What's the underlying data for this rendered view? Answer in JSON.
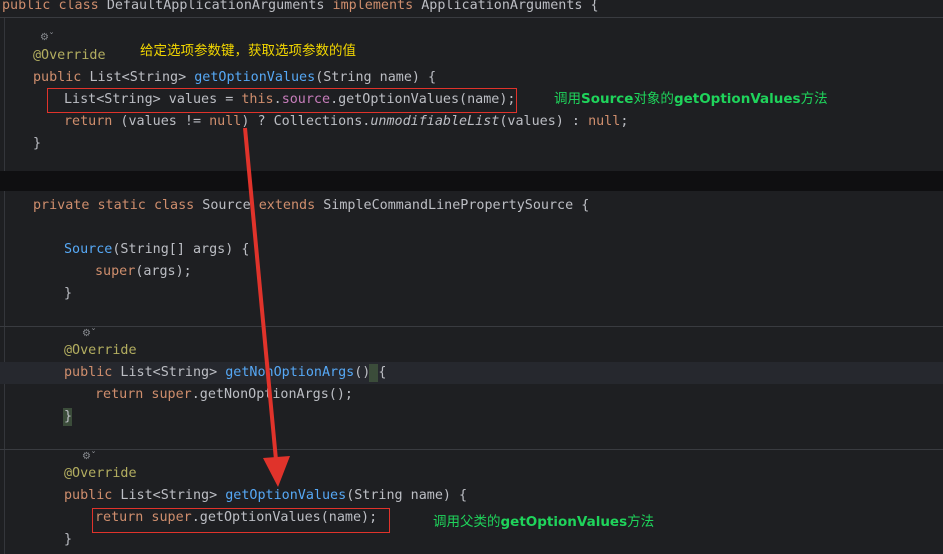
{
  "class_header": "public class DefaultApplicationArguments implements ApplicationArguments {",
  "class_header_parts": {
    "kw1": "public",
    "kw2": "class",
    "name": "DefaultApplicationArguments",
    "kw3": "implements",
    "iface": "ApplicationArguments",
    "brace": "{"
  },
  "block1": {
    "hint": "⚙ˇ",
    "annotation": "@Override",
    "sig_kw": "public",
    "sig_type": "List<String>",
    "sig_name": "getOptionValues",
    "sig_params": "(String name) {",
    "line2_type": "List<String> values = ",
    "line2_this": "this",
    "line2_dot": ".",
    "line2_field": "source",
    "line2_rest": ".getOptionValues(name);",
    "line3_kw": "return",
    "line3_a": " (values != ",
    "line3_null": "null",
    "line3_b": ") ? Collections.",
    "line3_it": "unmodifiableList",
    "line3_c": "(values) : ",
    "line3_null2": "null",
    "line3_end": ";",
    "close": "}"
  },
  "block2": {
    "kw1": "private",
    "kw2": "static",
    "kw3": "class",
    "name": " Source ",
    "kw4": "extends",
    "rest": " SimpleCommandLinePropertySource {",
    "ctor_name": "Source",
    "ctor_params": "(String[] args) {",
    "super_kw": "super",
    "super_rest": "(args);",
    "close": "}"
  },
  "block3": {
    "hint": "⚙ˇ",
    "annotation": "@Override",
    "sig_kw": "public",
    "sig_type": " List<String> ",
    "sig_name": "getNonOptionArgs",
    "sig_params": "() {",
    "ret_kw": "return",
    "ret_super": " super",
    "ret_rest": ".getNonOptionArgs();",
    "close": "}"
  },
  "block4": {
    "hint": "⚙ˇ",
    "annotation": "@Override",
    "sig_kw": "public",
    "sig_type": " List<String> ",
    "sig_name": "getOptionValues",
    "sig_params": "(String name) {",
    "ret_kw": "return",
    "ret_super": " super",
    "ret_rest": ".getOptionValues(name);",
    "close": "}"
  },
  "notes": {
    "top_yellow": "给定选项参数键，获取选项参数的值",
    "green1_a": "调用",
    "green1_b": "Source",
    "green1_c": "对象的",
    "green1_d": "getOptionValues",
    "green1_e": "方法",
    "green2_a": "调用父类的",
    "green2_b": "getOptionValues",
    "green2_c": "方法"
  },
  "colors": {
    "keyword": "#cf8e6d",
    "function": "#56a8f5",
    "annotation": "#b3ae60",
    "field": "#c77dbb",
    "highlight": "#e0332b",
    "note_green": "#1fd35b",
    "note_yellow": "#f2d600"
  }
}
